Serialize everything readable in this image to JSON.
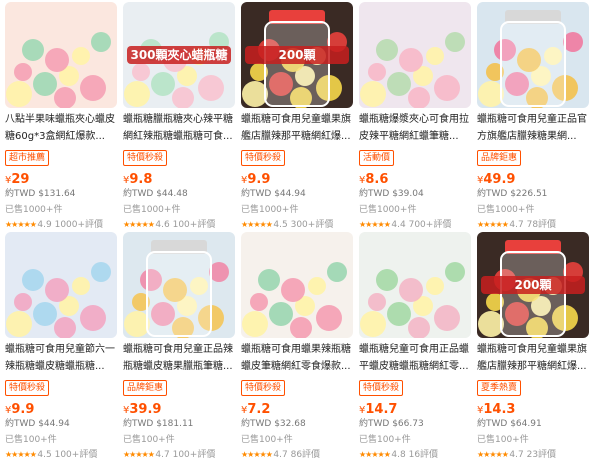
{
  "products": [
    {
      "title": "八點半果味蠟瓶夾心蠟皮糖60g*3盒網紅爆款...",
      "tag": "超市推薦",
      "currency": "¥",
      "price": "29",
      "approx": "約TWD $131.64",
      "sold": "已售1000+件",
      "rating": "4.9",
      "reviews": "1000+評價",
      "colors": [
        "#fbe7df",
        "#f5a1b5",
        "#9fd8b5"
      ],
      "banner": ""
    },
    {
      "title": "蠟瓶糖臘瓶糖夾心辣平糖網紅辣瓶糖蠟瓶糖可食...",
      "tag": "特價秒殺",
      "currency": "¥",
      "price": "9.8",
      "approx": "約TWD $44.48",
      "sold": "已售1000+件",
      "rating": "4.6",
      "reviews": "100+評價",
      "colors": [
        "#e9eef2",
        "#f8c3d0",
        "#b6e3c6"
      ],
      "banner": "300顆夾心蜡瓶糖"
    },
    {
      "title": "蠟瓶糖可食用兒童蠟果旗艦店臘辣那平糖網紅爆...",
      "tag": "特價秒殺",
      "currency": "¥",
      "price": "9.9",
      "approx": "約TWD $44.94",
      "sold": "已售1000+件",
      "rating": "4.5",
      "reviews": "300+評價",
      "colors": [
        "#3a2a24",
        "#f7d84b",
        "#e8403c"
      ],
      "banner": "200顆"
    },
    {
      "title": "蠟瓶糖爆漿夾心可食用拉皮辣平糖網紅蠟筆糖...",
      "tag": "活動價",
      "currency": "¥",
      "price": "8.6",
      "approx": "約TWD $39.04",
      "sold": "已售1000+件",
      "rating": "4.4",
      "reviews": "700+評價",
      "colors": [
        "#efe6ee",
        "#f7b8c8",
        "#b8dcb0"
      ],
      "banner": ""
    },
    {
      "title": "蠟瓶糖可食用兒童正品官方旗艦店臘辣糖果網...",
      "tag": "品牌鉅惠",
      "currency": "¥",
      "price": "49.9",
      "approx": "約TWD $226.51",
      "sold": "已售1000+件",
      "rating": "4.7",
      "reviews": "78評價",
      "colors": [
        "#d9e6ef",
        "#f3c14d",
        "#ef7aa0"
      ],
      "banner": ""
    },
    {
      "title": "蠟瓶糖可食用兒童節六一辣瓶糖蠟皮糖蠟瓶糖...",
      "tag": "特價秒殺",
      "currency": "¥",
      "price": "9.9",
      "approx": "約TWD $44.94",
      "sold": "已售100+件",
      "rating": "4.5",
      "reviews": "100+評價",
      "colors": [
        "#e3eaf4",
        "#f2a7c3",
        "#a7d7ee"
      ],
      "banner": ""
    },
    {
      "title": "蠟瓶糖可食用兒童正品辣瓶糖蠟皮糖果臘瓶筆糖...",
      "tag": "品牌鉅惠",
      "currency": "¥",
      "price": "39.9",
      "approx": "約TWD $181.11",
      "sold": "已售100+件",
      "rating": "4.7",
      "reviews": "100+評價",
      "colors": [
        "#dde8ef",
        "#f4c558",
        "#f08aa8"
      ],
      "banner": ""
    },
    {
      "title": "蠟瓶糖可食用蠟果辣瓶糖蠟皮筆糖網紅零食爆款...",
      "tag": "特價秒殺",
      "currency": "¥",
      "price": "7.2",
      "approx": "約TWD $32.68",
      "sold": "已售100+件",
      "rating": "4.7",
      "reviews": "86評價",
      "colors": [
        "#f6f1ec",
        "#f59fb4",
        "#9bd6b1"
      ],
      "banner": ""
    },
    {
      "title": "蠟瓶糖兒童可食用正品蠟平蠟皮糖蠟瓶糖網紅零...",
      "tag": "特價秒殺",
      "currency": "¥",
      "price": "14.7",
      "approx": "約TWD $66.73",
      "sold": "已售100+件",
      "rating": "4.8",
      "reviews": "16評價",
      "colors": [
        "#eef2ee",
        "#f3b7c7",
        "#a5d9a6"
      ],
      "banner": ""
    },
    {
      "title": "蠟瓶糖可食用兒童蠟果旗艦店臘辣那平糖網紅爆...",
      "tag": "夏季熱賣",
      "currency": "¥",
      "price": "14.3",
      "approx": "約TWD $64.91",
      "sold": "已售100+件",
      "rating": "4.7",
      "reviews": "23評價",
      "colors": [
        "#3a2a24",
        "#f7d84b",
        "#e8403c"
      ],
      "banner": "200顆"
    }
  ]
}
